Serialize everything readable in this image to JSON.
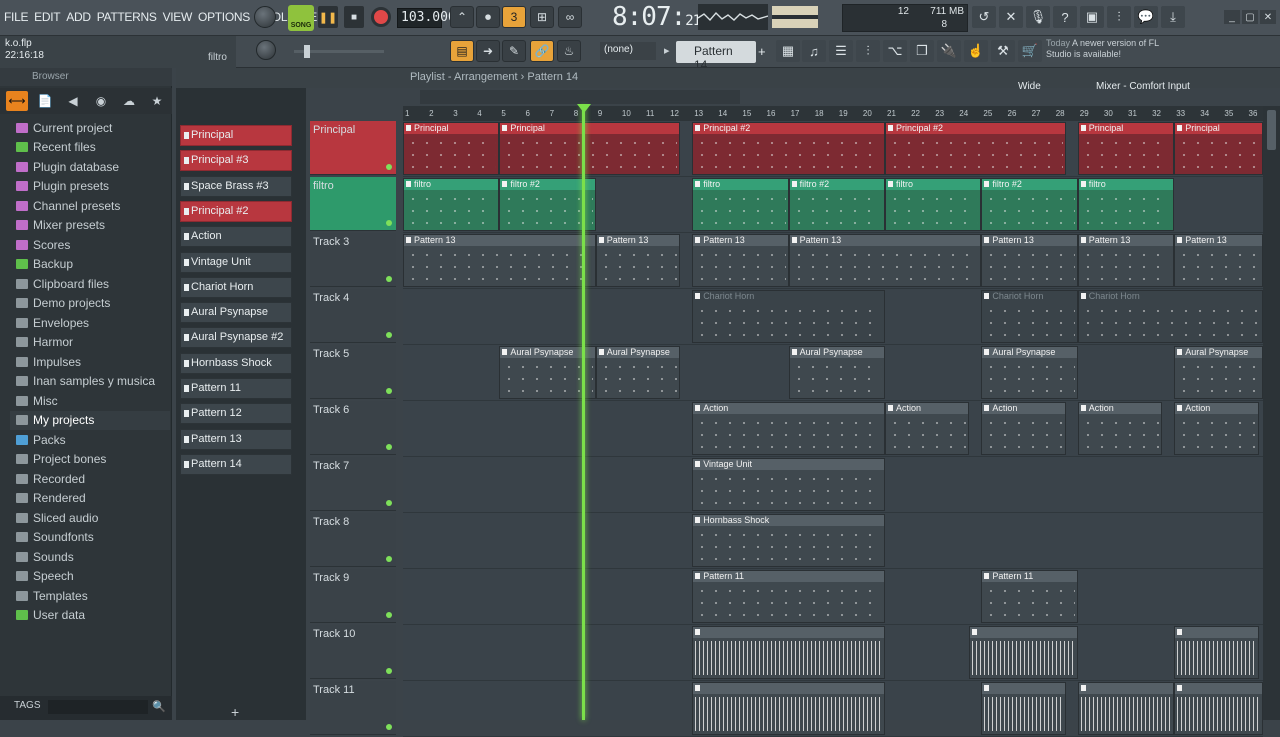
{
  "menu": [
    "FILE",
    "EDIT",
    "ADD",
    "PATTERNS",
    "VIEW",
    "OPTIONS",
    "TOOLS",
    "HELP"
  ],
  "transport": {
    "song_label": "SONG",
    "tempo": "103.000",
    "time_main": "8:07",
    "time_sub": "21"
  },
  "cpu": {
    "voices": "12",
    "memory": "711 MB",
    "polyphony": "8"
  },
  "hint": {
    "file": "k.o.flp",
    "time": "22:16:18",
    "channel": "filtro"
  },
  "pattern": {
    "none_label": "(none)",
    "selected": "Pattern 14"
  },
  "news": {
    "when": "Today",
    "text": "A newer version of FL Studio is available!"
  },
  "browser": {
    "title": "Browser",
    "items": [
      {
        "label": "Current project",
        "color": "#c06ec9"
      },
      {
        "label": "Recent files",
        "color": "#5fbf4b"
      },
      {
        "label": "Plugin database",
        "color": "#c06ec9"
      },
      {
        "label": "Plugin presets",
        "color": "#c06ec9"
      },
      {
        "label": "Channel presets",
        "color": "#c06ec9"
      },
      {
        "label": "Mixer presets",
        "color": "#c06ec9"
      },
      {
        "label": "Scores",
        "color": "#c06ec9"
      },
      {
        "label": "Backup",
        "color": "#5fbf4b"
      },
      {
        "label": "Clipboard files",
        "color": "#8d979c"
      },
      {
        "label": "Demo projects",
        "color": "#8d979c"
      },
      {
        "label": "Envelopes",
        "color": "#8d979c"
      },
      {
        "label": "Harmor",
        "color": "#8d979c"
      },
      {
        "label": "Impulses",
        "color": "#8d979c"
      },
      {
        "label": "Inan samples y musica",
        "color": "#8d979c"
      },
      {
        "label": "Misc",
        "color": "#8d979c"
      },
      {
        "label": "My projects",
        "color": "#8d979c",
        "selected": true
      },
      {
        "label": "Packs",
        "color": "#4f9fd6"
      },
      {
        "label": "Project bones",
        "color": "#8d979c"
      },
      {
        "label": "Recorded",
        "color": "#8d979c"
      },
      {
        "label": "Rendered",
        "color": "#8d979c"
      },
      {
        "label": "Sliced audio",
        "color": "#8d979c"
      },
      {
        "label": "Soundfonts",
        "color": "#8d979c"
      },
      {
        "label": "Sounds",
        "color": "#8d979c"
      },
      {
        "label": "Speech",
        "color": "#8d979c"
      },
      {
        "label": "Templates",
        "color": "#8d979c"
      },
      {
        "label": "User data",
        "color": "#5fbf4b"
      }
    ],
    "tags_label": "TAGS"
  },
  "channels": [
    {
      "label": "Principal",
      "red": true
    },
    {
      "label": "Principal #3",
      "red": true
    },
    {
      "label": "Space Brass #3",
      "red": false
    },
    {
      "label": "Principal #2",
      "red": true
    },
    {
      "label": "Action",
      "red": false
    },
    {
      "label": "Vintage Unit",
      "red": false
    },
    {
      "label": "Chariot Horn",
      "red": false
    },
    {
      "label": "Aural Psynapse",
      "red": false
    },
    {
      "label": "Aural Psynapse #2",
      "red": false
    },
    {
      "label": "Hornbass Shock",
      "red": false
    },
    {
      "label": "Pattern 11",
      "red": false
    },
    {
      "label": "Pattern 12",
      "red": false
    },
    {
      "label": "Pattern 13",
      "red": false
    },
    {
      "label": "Pattern 14",
      "red": false
    }
  ],
  "playlist": {
    "title": "Playlist - Arrangement",
    "pattern": "Pattern 14",
    "mixer_title": "Mixer - Comfort Input",
    "wide_label": "Wide",
    "ruler": [
      "1",
      "2",
      "3",
      "4",
      "5",
      "6",
      "7",
      "8",
      "9",
      "10",
      "11",
      "12",
      "13",
      "14",
      "15",
      "16",
      "17",
      "18",
      "19",
      "20",
      "21",
      "22",
      "23",
      "24",
      "25",
      "26",
      "27",
      "28",
      "29",
      "30",
      "31",
      "32",
      "33",
      "34",
      "35",
      "36"
    ],
    "tracks": [
      {
        "name": "Principal",
        "style": "red",
        "clips": [
          {
            "label": "Principal",
            "s": 1,
            "e": 5,
            "c": "red"
          },
          {
            "label": "Principal",
            "s": 5,
            "e": 12.5,
            "c": "red"
          },
          {
            "label": "Principal #2",
            "s": 13,
            "e": 21,
            "c": "red"
          },
          {
            "label": "Principal #2",
            "s": 21,
            "e": 28.5,
            "c": "red"
          },
          {
            "label": "Principal",
            "s": 29,
            "e": 33,
            "c": "red"
          },
          {
            "label": "Principal",
            "s": 33,
            "e": 37,
            "c": "red"
          }
        ]
      },
      {
        "name": "filtro",
        "style": "grn",
        "clips": [
          {
            "label": "filtro",
            "s": 1,
            "e": 5,
            "c": "grn"
          },
          {
            "label": "filtro #2",
            "s": 5,
            "e": 9,
            "c": "grn"
          },
          {
            "label": "filtro",
            "s": 13,
            "e": 17,
            "c": "grn"
          },
          {
            "label": "filtro #2",
            "s": 17,
            "e": 21,
            "c": "grn"
          },
          {
            "label": "filtro",
            "s": 21,
            "e": 25,
            "c": "grn"
          },
          {
            "label": "filtro #2",
            "s": 25,
            "e": 29,
            "c": "grn"
          },
          {
            "label": "filtro",
            "s": 29,
            "e": 33,
            "c": "grn"
          }
        ]
      },
      {
        "name": "Track 3",
        "style": "",
        "clips": [
          {
            "label": "Pattern 13",
            "s": 1,
            "e": 9,
            "c": "gry"
          },
          {
            "label": "Pattern 13",
            "s": 9,
            "e": 12.5,
            "c": "gry"
          },
          {
            "label": "Pattern 13",
            "s": 13,
            "e": 17,
            "c": "gry"
          },
          {
            "label": "Pattern 13",
            "s": 17,
            "e": 25,
            "c": "gry"
          },
          {
            "label": "Pattern 13",
            "s": 25,
            "e": 29,
            "c": "gry"
          },
          {
            "label": "Pattern 13",
            "s": 29,
            "e": 33,
            "c": "gry"
          },
          {
            "label": "Pattern 13",
            "s": 33,
            "e": 37,
            "c": "gry"
          }
        ]
      },
      {
        "name": "Track 4",
        "style": "",
        "clips": [
          {
            "label": "Chariot Horn",
            "s": 13,
            "e": 21,
            "c": "dim"
          },
          {
            "label": "Chariot Horn",
            "s": 25,
            "e": 29,
            "c": "dim"
          },
          {
            "label": "Chariot Horn",
            "s": 29,
            "e": 37,
            "c": "dim"
          }
        ]
      },
      {
        "name": "Track 5",
        "style": "",
        "clips": [
          {
            "label": "Aural Psynapse",
            "s": 5,
            "e": 9,
            "c": "gry"
          },
          {
            "label": "Aural Psynapse",
            "s": 9,
            "e": 12.5,
            "c": "gry"
          },
          {
            "label": "Aural Psynapse",
            "s": 17,
            "e": 21,
            "c": "gry"
          },
          {
            "label": "Aural Psynapse",
            "s": 25,
            "e": 29,
            "c": "gry"
          },
          {
            "label": "Aural Psynapse",
            "s": 33,
            "e": 37,
            "c": "gry"
          }
        ]
      },
      {
        "name": "Track 6",
        "style": "",
        "clips": [
          {
            "label": "Action",
            "s": 13,
            "e": 21,
            "c": "gry"
          },
          {
            "label": "Action",
            "s": 21,
            "e": 24.5,
            "c": "gry"
          },
          {
            "label": "Action",
            "s": 25,
            "e": 28.5,
            "c": "gry"
          },
          {
            "label": "Action",
            "s": 29,
            "e": 32.5,
            "c": "gry"
          },
          {
            "label": "Action",
            "s": 33,
            "e": 36.5,
            "c": "gry"
          }
        ]
      },
      {
        "name": "Track 7",
        "style": "",
        "clips": [
          {
            "label": "Vintage Unit",
            "s": 13,
            "e": 21,
            "c": "gry"
          }
        ]
      },
      {
        "name": "Track 8",
        "style": "",
        "clips": [
          {
            "label": "Hornbass Shock",
            "s": 13,
            "e": 21,
            "c": "gry"
          }
        ]
      },
      {
        "name": "Track 9",
        "style": "",
        "clips": [
          {
            "label": "Pattern 11",
            "s": 13,
            "e": 21,
            "c": "gry"
          },
          {
            "label": "Pattern 11",
            "s": 25,
            "e": 29,
            "c": "gry"
          }
        ]
      },
      {
        "name": "Track 10",
        "style": "",
        "clips": [
          {
            "label": "",
            "s": 13,
            "e": 21,
            "c": "bars"
          },
          {
            "label": "",
            "s": 24.5,
            "e": 29,
            "c": "bars"
          },
          {
            "label": "",
            "s": 33,
            "e": 36.5,
            "c": "bars"
          }
        ]
      },
      {
        "name": "Track 11",
        "style": "",
        "clips": [
          {
            "label": "",
            "s": 13,
            "e": 21,
            "c": "bars"
          },
          {
            "label": "",
            "s": 25,
            "e": 28.5,
            "c": "bars"
          },
          {
            "label": "",
            "s": 29,
            "e": 33,
            "c": "bars"
          },
          {
            "label": "",
            "s": 33,
            "e": 37,
            "c": "bars"
          }
        ]
      }
    ]
  }
}
